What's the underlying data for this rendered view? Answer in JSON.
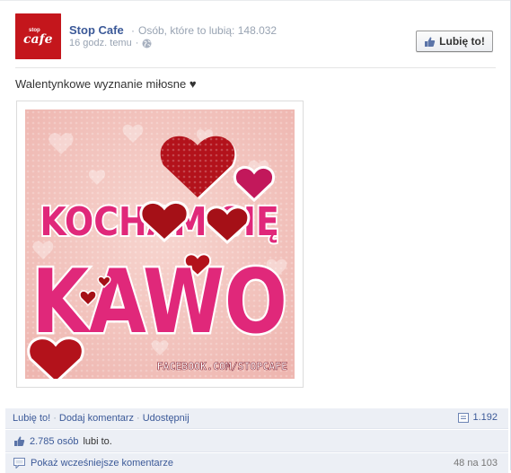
{
  "page": {
    "name": "Stop Cafe",
    "likes_text": "Osób, które to lubią: 148.032",
    "time": "16 godz. temu",
    "like_button": "Lubię to!",
    "logo_text_top": "stop",
    "logo_text_main": "cafe"
  },
  "post": {
    "text": "Walentynkowe wyznanie miłosne ♥",
    "image": {
      "line1": "KOCHAM SIĘ",
      "line2": "KAWO",
      "watermark": "FACEBOOK.COM/STOPCAFE"
    }
  },
  "actions": {
    "like": "Lubię to!",
    "comment": "Dodaj komentarz",
    "share": "Udostępnij",
    "share_count": "1.192"
  },
  "likes": {
    "count": "2.785 osób",
    "suffix": "lubi to."
  },
  "comments": {
    "view_more": "Pokaż wcześniejsze komentarze",
    "pager": "48 na 103"
  },
  "colors": {
    "link": "#3b5998",
    "brand_red": "#c4161c",
    "text_pink": "#e0287a",
    "heart_red": "#b3121b",
    "bg_pink": "#f2c6c0"
  }
}
